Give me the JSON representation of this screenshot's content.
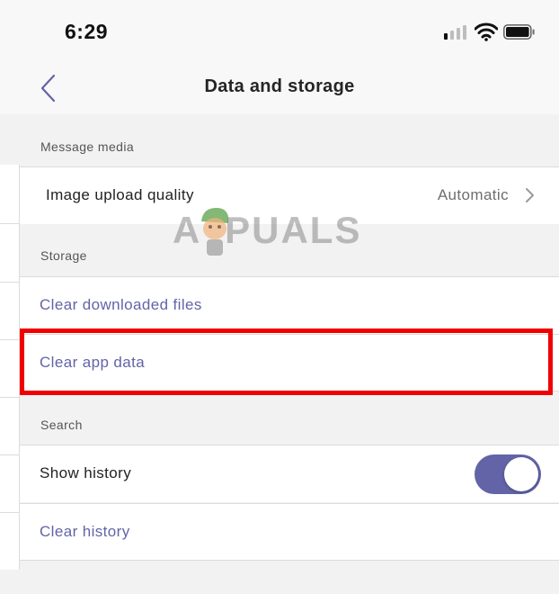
{
  "status_bar": {
    "time": "6:29",
    "signal_bars_filled": 1,
    "signal_bars_total": 4,
    "icons": [
      "signal-icon",
      "wifi-icon",
      "battery-icon"
    ]
  },
  "nav": {
    "back_icon": "chevron-left-icon",
    "title": "Data and storage"
  },
  "sections": {
    "message_media": {
      "header": "Message media",
      "image_upload": {
        "label": "Image upload quality",
        "value": "Automatic"
      }
    },
    "storage": {
      "header": "Storage",
      "clear_downloaded": "Clear downloaded files",
      "clear_app_data": "Clear app data"
    },
    "search": {
      "header": "Search",
      "show_history": {
        "label": "Show history",
        "enabled": true
      },
      "clear_history": "Clear history"
    }
  },
  "watermark": {
    "text": "A  PUALS"
  },
  "colors": {
    "accent": "#6264a7",
    "highlight": "#f00000",
    "background": "#f2f2f2",
    "nav_background": "#f8f8f8"
  }
}
